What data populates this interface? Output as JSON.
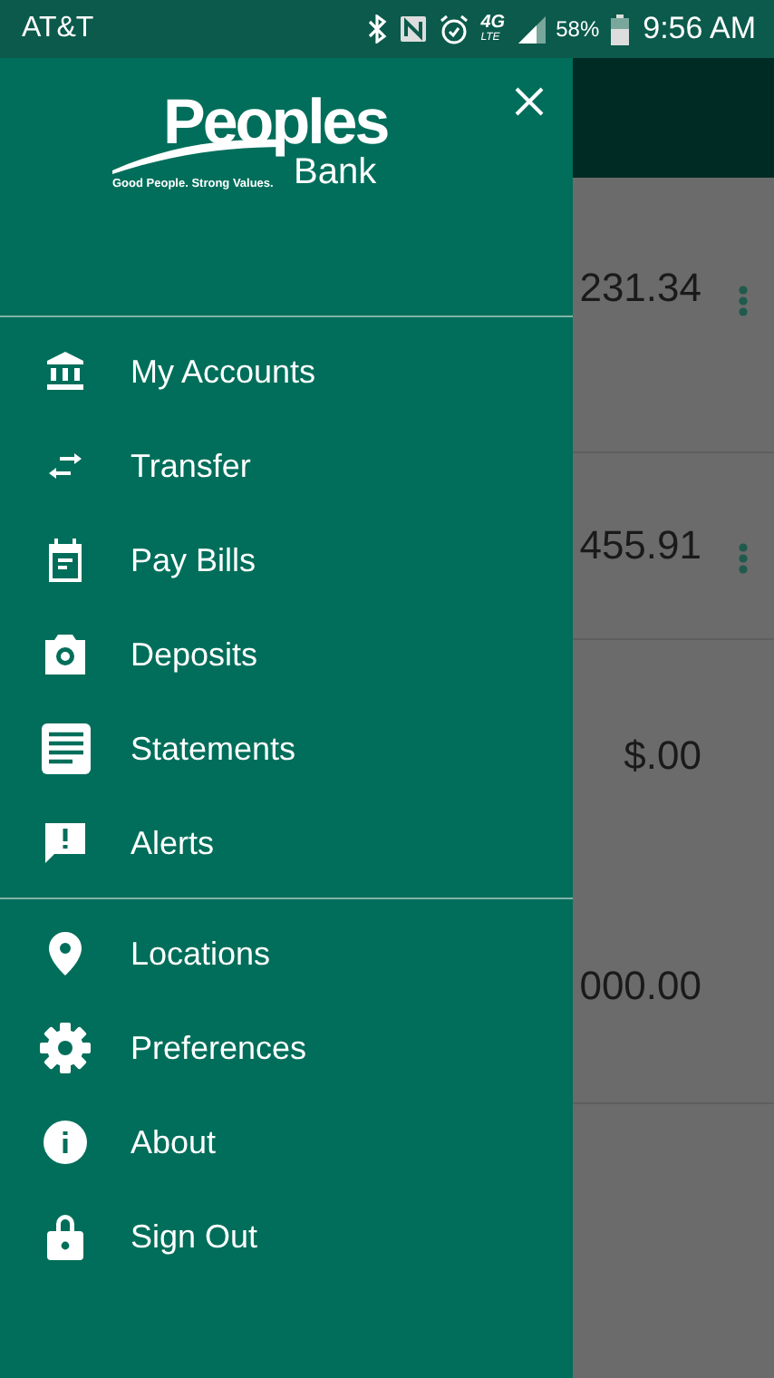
{
  "status_bar": {
    "carrier": "AT&T",
    "network_type": "4G",
    "network_sub": "LTE",
    "battery_percent": "58%",
    "time": "9:56 AM"
  },
  "drawer": {
    "logo": {
      "name": "Peoples",
      "sub": "Bank",
      "tagline": "Good People. Strong Values."
    },
    "sections": [
      [
        {
          "kind": "bank",
          "label": "My Accounts"
        },
        {
          "kind": "transfer",
          "label": "Transfer"
        },
        {
          "kind": "calendar",
          "label": "Pay Bills"
        },
        {
          "kind": "camera",
          "label": "Deposits"
        },
        {
          "kind": "list",
          "label": "Statements"
        },
        {
          "kind": "alert",
          "label": "Alerts"
        }
      ],
      [
        {
          "kind": "pin",
          "label": "Locations"
        },
        {
          "kind": "gear",
          "label": "Preferences"
        },
        {
          "kind": "info",
          "label": "About"
        },
        {
          "kind": "lock",
          "label": "Sign Out"
        }
      ]
    ]
  },
  "background": {
    "rows": [
      {
        "amounts": [
          "231.34"
        ],
        "menu": true
      },
      {
        "amounts": [
          "455.91"
        ],
        "menu": true
      },
      {
        "amounts": [
          "$.00",
          "000.00"
        ],
        "menu": false
      }
    ]
  }
}
